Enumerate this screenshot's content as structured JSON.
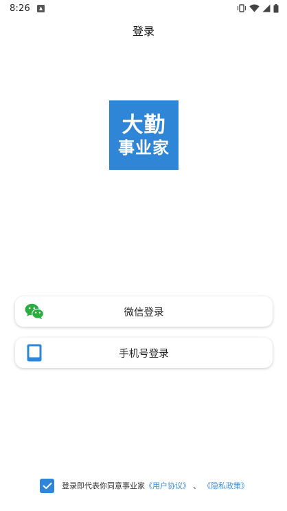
{
  "status_bar": {
    "time": "8:26"
  },
  "page": {
    "title": "登录"
  },
  "logo": {
    "line1": "大勤",
    "line2": "事业家",
    "color": "#2f86d6"
  },
  "buttons": {
    "wechat_label": "微信登录",
    "wechat_icon": "wechat-icon",
    "phone_label": "手机号登录",
    "phone_icon": "phone-icon"
  },
  "agreement": {
    "checked": true,
    "text": "登录即代表你同意事业家",
    "user_agreement": "《用户协议》",
    "separator": "、",
    "privacy_policy": "《隐私政策》",
    "link_color": "#3a8ee0"
  }
}
